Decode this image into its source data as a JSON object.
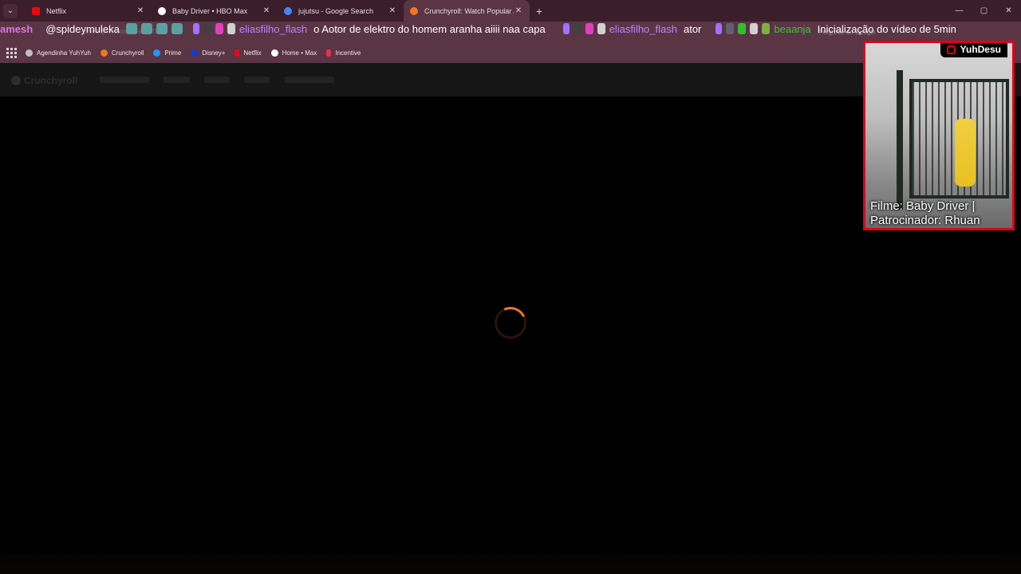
{
  "tabs": [
    {
      "title": "Netflix",
      "favicon_color": "#e50914",
      "active": false
    },
    {
      "title": "Baby Driver • HBO Max",
      "favicon_color": "#ffffff",
      "active": false
    },
    {
      "title": "jujutsu - Google Search",
      "favicon_color": "#4285f4",
      "active": false
    },
    {
      "title": "Crunchyroll: Watch Popular Ani",
      "favicon_color": "#f47521",
      "active": true
    }
  ],
  "window_controls": {
    "minimize": "—",
    "maximize": "▢",
    "close": "✕"
  },
  "address": {
    "url": "crunchyroll.com/...GRDV0...",
    "search_placeholder": "Pergunte ao Google"
  },
  "ticker": [
    {
      "user": "amesh",
      "user_color": "#e070e0",
      "message": ""
    },
    {
      "user": "@spideymuleka",
      "user_color": "#ffffff",
      "message": ""
    },
    {
      "user": "eliasfilho_flash",
      "user_color": "#c080ff",
      "message": "o Aotor de elektro do homem aranha aiiii naa capa"
    },
    {
      "user": "eliasfilho_flash",
      "user_color": "#c080ff",
      "message": "ator"
    },
    {
      "user": "beaanja",
      "user_color": "#40c040",
      "message": "Inicialização do vídeo de 5min"
    }
  ],
  "bookmarks": [
    {
      "label": "Agendinha YuhYuh",
      "color": "#c0c0c0"
    },
    {
      "label": "Crunchyroll",
      "color": "#f47521"
    },
    {
      "label": "Prime",
      "color": "#1a98ff"
    },
    {
      "label": "Disney+",
      "color": "#113ccf"
    },
    {
      "label": "Netflix",
      "color": "#e50914"
    },
    {
      "label": "Home • Max",
      "color": "#ffffff"
    },
    {
      "label": "Incentive",
      "color": "#e0304a"
    }
  ],
  "crunchyroll": {
    "logo": "Crunchyroll"
  },
  "overlay": {
    "brand": "YuhDesu",
    "caption_line1": "Filme: Baby Driver |",
    "caption_line2": "Patrocinador: Rhuan"
  }
}
